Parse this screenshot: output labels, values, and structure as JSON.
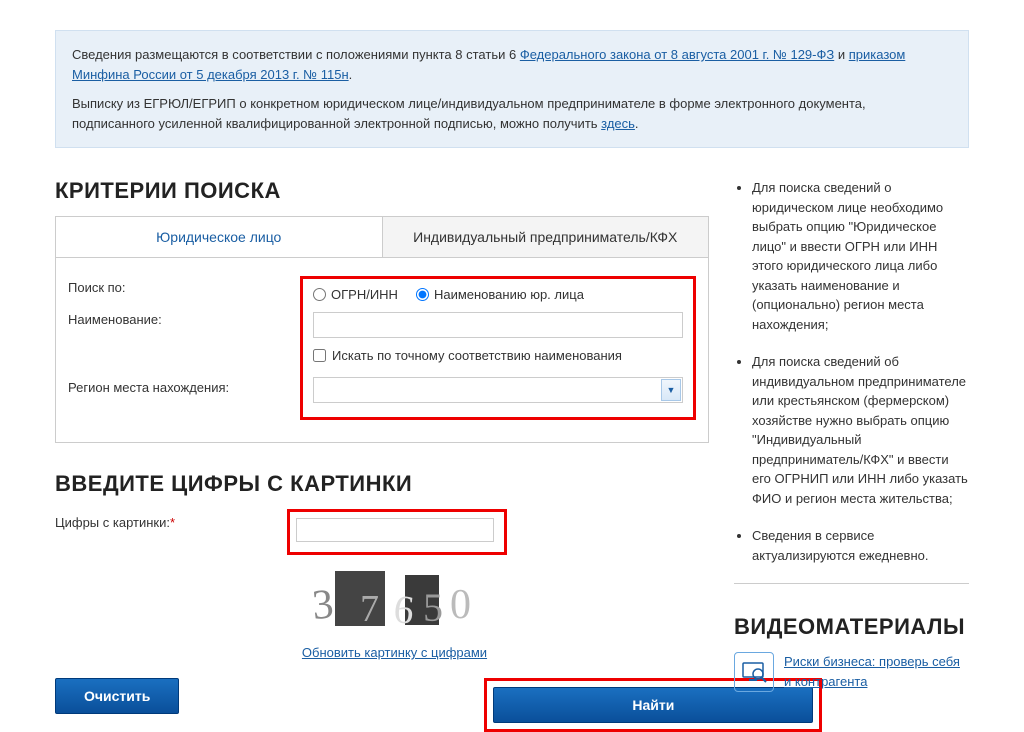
{
  "info": {
    "text1_prefix": "Сведения размещаются в соответствии с положениями пункта 8 статьи 6 ",
    "link1": "Федерального закона от 8 августа 2001 г. № 129-ФЗ",
    "text1_mid": " и ",
    "link2": "приказом Минфина России от 5 декабря 2013 г. № 115н",
    "text1_suffix": ".",
    "text2_prefix": "Выписку из ЕГРЮЛ/ЕГРИП о конкретном юридическом лице/индивидуальном предпринимателе в форме электронного документа, подписанного усиленной квалифицированной электронной подписью, можно получить ",
    "link3": "здесь",
    "text2_suffix": "."
  },
  "search": {
    "heading": "КРИТЕРИИ ПОИСКА",
    "tab_legal": "Юридическое лицо",
    "tab_ip": "Индивидуальный предприниматель/КФХ",
    "search_by_label": "Поиск по:",
    "radio_ogrn": "ОГРН/ИНН",
    "radio_name": "Наименованию юр. лица",
    "name_label": "Наименование:",
    "exact_match": "Искать по точному соответствию наименования",
    "region_label": "Регион места нахождения:"
  },
  "captcha": {
    "heading": "ВВЕДИТЕ ЦИФРЫ С КАРТИНКИ",
    "label": "Цифры с картинки:",
    "required": "*",
    "refresh": "Обновить картинку с цифрами"
  },
  "buttons": {
    "clear": "Очистить",
    "find": "Найти"
  },
  "help": {
    "items": [
      "Для поиска сведений о юридическом лице необходимо выбрать опцию \"Юридическое лицо\" и ввести ОГРН или ИНН этого юридического лица либо указать наименование и (опционально) регион места нахождения;",
      "Для поиска сведений об индивидуальном предпринимателе или крестьянском (фермерском) хозяйстве нужно выбрать опцию \"Индивидуальный предприниматель/КФХ\" и ввести его ОГРНИП или ИНН либо указать ФИО и регион места жительства;",
      "Сведения в сервисе актуализируются ежедневно."
    ]
  },
  "video": {
    "heading": "ВИДЕОМАТЕРИАЛЫ",
    "link": "Риски бизнеса: проверь себя и контрагента"
  }
}
